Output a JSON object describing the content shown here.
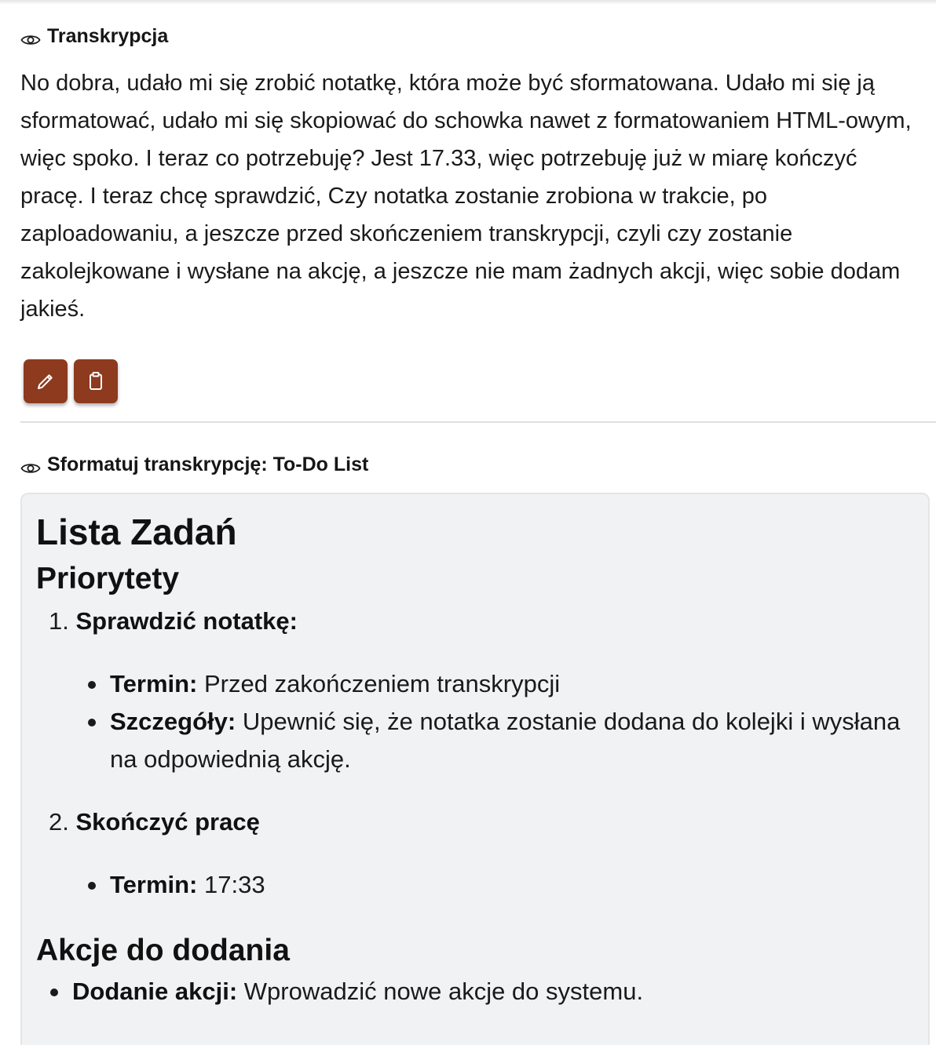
{
  "transcription": {
    "header_icon": "eye-icon",
    "title": "Transkrypcja",
    "text": "No dobra, udało mi się zrobić notatkę, która może być sformatowana. Udało mi się ją sformatować, udało mi się skopiować do schowka nawet z formatowaniem HTML-owym, więc spoko. I teraz co potrzebuję? Jest 17.33, więc potrzebuję już w miarę kończyć pracę. I teraz chcę sprawdzić, Czy notatka zostanie zrobiona w trakcie, po zaploadowaniu, a jeszcze przed skończeniem transkrypcji, czyli czy zostanie zakolejkowane i wysłane na akcję, a jeszcze nie mam żadnych akcji, więc sobie dodam jakieś."
  },
  "actions": {
    "edit_icon": "pencil-icon",
    "copy_icon": "clipboard-icon",
    "button_color": "#8d3a1f"
  },
  "formatted": {
    "header_icon": "eye-icon",
    "title": "Sformatuj transkrypcję: To-Do List",
    "doc": {
      "title": "Lista Zadań",
      "priorities_heading": "Priorytety",
      "item1": {
        "number": "1.",
        "title": "Sprawdzić notatkę:",
        "bullets": [
          {
            "label": "Termin:",
            "text": " Przed zakończeniem transkrypcji"
          },
          {
            "label": "Szczegóły:",
            "text": " Upewnić się, że notatka zostanie dodana do kolejki i wysłana",
            "text_cont": "na odpowiednią akcję."
          }
        ]
      },
      "item2": {
        "number": "2.",
        "title": "Skończyć pracę",
        "bullets": [
          {
            "label": "Termin:",
            "text": " 17:33"
          }
        ]
      },
      "actions_heading": "Akcje do dodania",
      "actions_bullets": [
        {
          "label": "Dodanie akcji:",
          "text": " Wprowadzić nowe akcje do systemu."
        }
      ]
    }
  }
}
